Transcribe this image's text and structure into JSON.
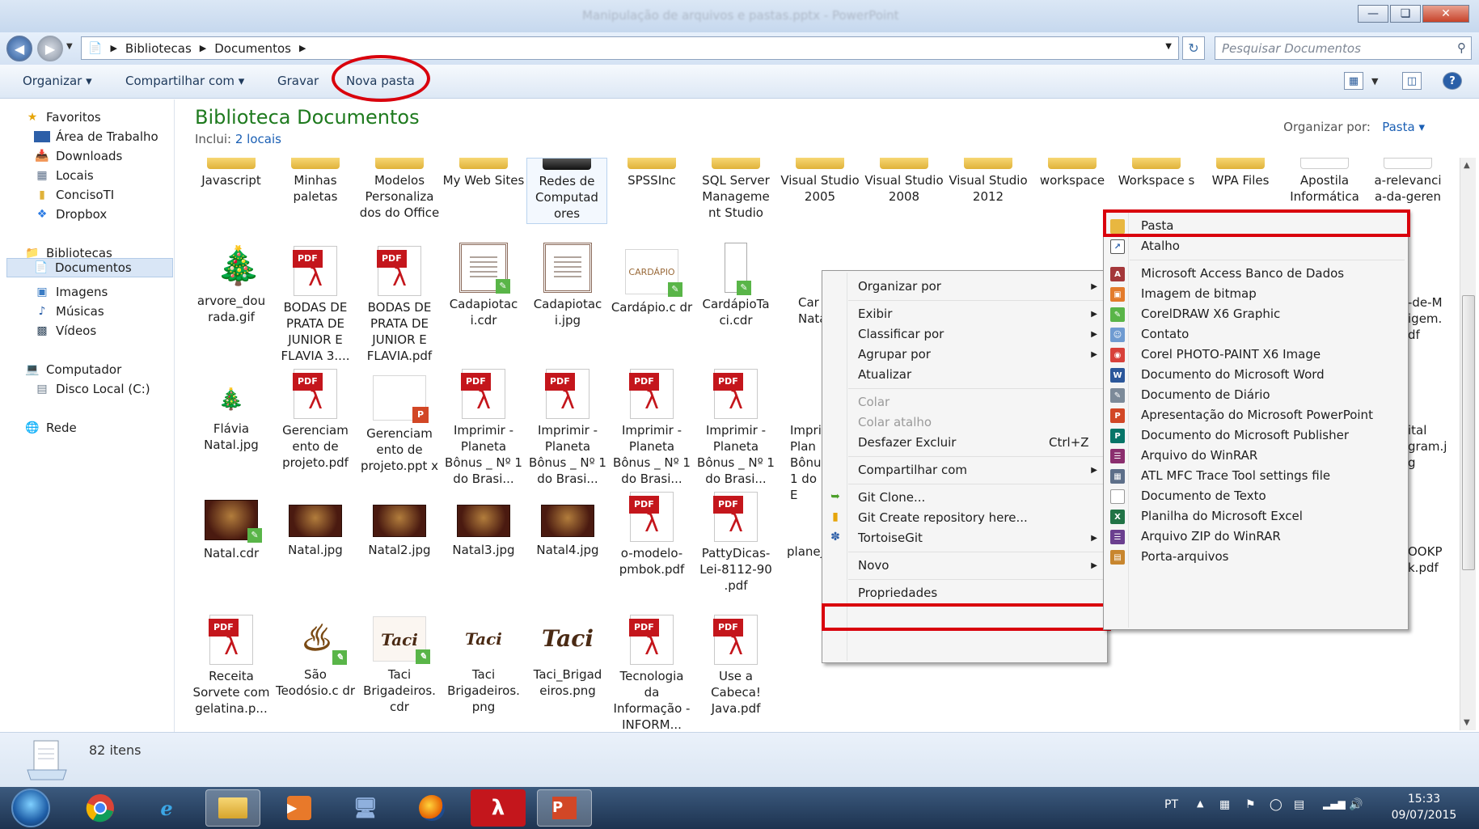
{
  "window": {
    "title": "Manipulação de arquivos e pastas.pptx - PowerPoint"
  },
  "address": {
    "crumbs": [
      "Bibliotecas",
      "Documentos"
    ],
    "search_placeholder": "Pesquisar Documentos"
  },
  "toolbar": {
    "organizar": "Organizar",
    "compartilhar": "Compartilhar com",
    "gravar": "Gravar",
    "nova_pasta": "Nova pasta"
  },
  "sidebar": {
    "favoritos": "Favoritos",
    "fav_items": [
      "Área de Trabalho",
      "Downloads",
      "Locais",
      "ConcisoTI",
      "Dropbox"
    ],
    "bibliotecas": "Bibliotecas",
    "lib_items": [
      "Documentos",
      "Imagens",
      "Músicas",
      "Vídeos"
    ],
    "computador": "Computador",
    "disco": "Disco Local (C:)",
    "rede": "Rede"
  },
  "main": {
    "title": "Biblioteca Documentos",
    "includes_label": "Inclui:",
    "includes_link": "2 locais",
    "organize_label": "Organizar por:",
    "organize_value": "Pasta"
  },
  "files": {
    "row1": [
      "Javascript",
      "Minhas paletas",
      "Modelos Personaliza dos do Office",
      "My Web Sites",
      "Redes de Computad ores",
      "SPSSInc",
      "SQL Server Manageme nt Studio",
      "Visual Studio 2005",
      "Visual Studio 2008",
      "Visual Studio 2012",
      "workspace",
      "Workspace s",
      "WPA Files",
      "Apostila Informática",
      "a-relevanci a-da-geren"
    ],
    "row2": [
      "arvore_dou rada.gif",
      "BODAS DE PRATA DE JUNIOR E FLAVIA 3....",
      "BODAS DE PRATA DE JUNIOR E FLAVIA.pdf",
      "Cadapiotac i.cdr",
      "Cadapiotac i.jpg",
      "Cardápio.c dr",
      "CardápioTa ci.cdr",
      "Car Natal",
      "-de-M igem. df"
    ],
    "row3": [
      "Flávia Natal.jpg",
      "Gerenciam ento de projeto.pdf",
      "Gerenciam ento de projeto.ppt x",
      "Imprimir - Planeta Bônus _ Nº 1 do Brasi...",
      "Imprimir - Planeta Bônus _ Nº 1 do Brasi...",
      "Imprimir - Planeta Bônus _ Nº 1 do Brasi...",
      "Imprimir - Planeta Bônus _ Nº 1 do Brasi...",
      "Impri Plan Bônu 1 do E",
      "ital gram.j g"
    ],
    "row4": [
      "Natal.cdr",
      "Natal.jpg",
      "Natal2.jpg",
      "Natal3.jpg",
      "Natal4.jpg",
      "o-modelo- pmbok.pdf",
      "PattyDicas- Lei-8112-90 .pdf",
      "planej",
      "OOKP k.pdf"
    ],
    "row5": [
      "Receita Sorvete com gelatina.p...",
      "São Teodósio.c dr",
      "Taci Brigadeiros. cdr",
      "Taci Brigadeiros. png",
      "Taci_Brigad eiros.png",
      "Tecnologia da Informação - INFORM...",
      "Use a Cabeca! Java.pdf"
    ],
    "pdf_tag": "PDF",
    "cardapio_label": "CARDÁPIO",
    "logo_text": "Taci"
  },
  "context_menu": {
    "items": [
      {
        "label": "Organizar por",
        "sub": true
      },
      {
        "label": "Exibir",
        "sub": true
      },
      {
        "label": "Classificar por",
        "sub": true
      },
      {
        "label": "Agrupar por",
        "sub": true
      },
      {
        "label": "Atualizar"
      },
      {
        "label": "Colar",
        "disabled": true
      },
      {
        "label": "Colar atalho",
        "disabled": true
      },
      {
        "label": "Desfazer Excluir",
        "shortcut": "Ctrl+Z"
      },
      {
        "label": "Compartilhar com",
        "sub": true
      },
      {
        "label": "Git Clone..."
      },
      {
        "label": "Git Create repository here..."
      },
      {
        "label": "TortoiseGit",
        "sub": true
      },
      {
        "label": "Novo",
        "sub": true
      },
      {
        "label": "Propriedades"
      }
    ]
  },
  "submenu_novo": {
    "items": [
      "Pasta",
      "Atalho",
      "Microsoft Access Banco de Dados",
      "Imagem de bitmap",
      "CorelDRAW X6 Graphic",
      "Contato",
      "Corel PHOTO-PAINT X6 Image",
      "Documento do Microsoft Word",
      "Documento de Diário",
      "Apresentação do Microsoft PowerPoint",
      "Documento do Microsoft Publisher",
      "Arquivo do WinRAR",
      "ATL MFC Trace Tool settings file",
      "Documento de Texto",
      "Planilha do Microsoft Excel",
      "Arquivo ZIP do WinRAR",
      "Porta-arquivos"
    ]
  },
  "status": {
    "count": "82 itens"
  },
  "taskbar": {
    "lang": "PT",
    "time": "15:33",
    "date": "09/07/2015"
  },
  "colors": {
    "accent_red": "#d9000c",
    "title_green": "#1e7a1e",
    "link_blue": "#1a5fb4"
  }
}
